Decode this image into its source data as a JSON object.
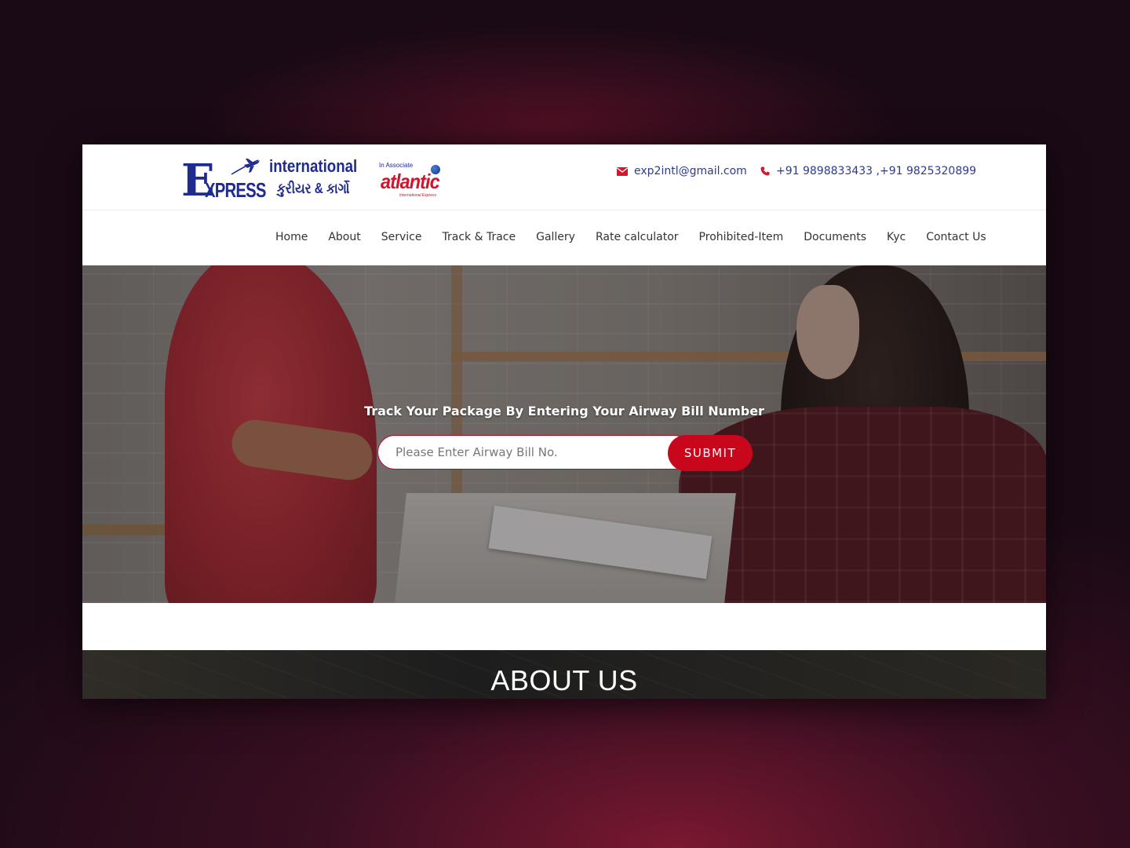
{
  "header": {
    "logo": {
      "big_letter": "E",
      "word": "XPRESS",
      "top_word": "international",
      "gujarati": "કુરીયર & કાર્ગો",
      "associate_label": "In Associate",
      "associate_brand": "atlantic",
      "associate_sub": "International Express"
    },
    "email": "exp2intl@gmail.com",
    "phone": "+91 9898833433 ,+91 9825320899",
    "colors": {
      "brand_blue": "#1e2b8f",
      "accent_red": "#c8061c"
    },
    "icons": {
      "email": "envelope-icon",
      "phone": "phone-icon"
    }
  },
  "nav": {
    "items": [
      {
        "label": "Home"
      },
      {
        "label": "About"
      },
      {
        "label": "Service"
      },
      {
        "label": "Track & Trace"
      },
      {
        "label": "Gallery"
      },
      {
        "label": "Rate calculator"
      },
      {
        "label": "Prohibited-Item"
      },
      {
        "label": "Documents"
      },
      {
        "label": "Kyc"
      },
      {
        "label": "Contact Us"
      }
    ]
  },
  "hero": {
    "headline": "Track Your Package By Entering Your Airway Bill Number",
    "input_placeholder": "Please Enter Airway Bill No.",
    "submit_label": "SUBMIT"
  },
  "about": {
    "title": "ABOUT US"
  }
}
